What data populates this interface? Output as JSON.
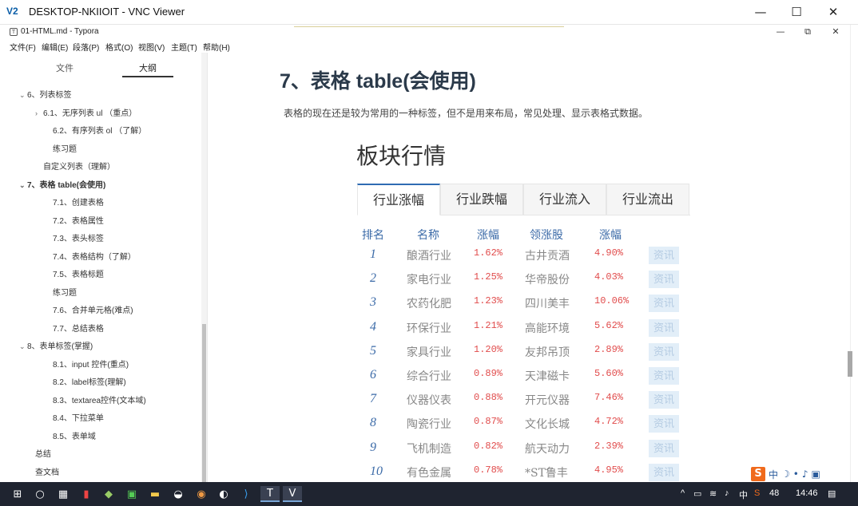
{
  "vnc": {
    "title": "DESKTOP-NKIIOIT - VNC Viewer",
    "logo": "V2",
    "min": "—",
    "max": "☐",
    "close": "✕"
  },
  "typora": {
    "title": "01-HTML.md - Typora",
    "icon": "T",
    "min": "—",
    "max": "⧉",
    "close": "✕"
  },
  "menu": [
    "文件(F)",
    "编辑(E)",
    "段落(P)",
    "格式(O)",
    "视图(V)",
    "主题(T)",
    "帮助(H)"
  ],
  "sidebar": {
    "tabs": [
      "文件",
      "大纲"
    ],
    "active_tab": "大纲",
    "items": [
      {
        "label": "6、列表标签",
        "caret": "⌄",
        "bold": false
      },
      {
        "label": "6.1、无序列表 ul （重点）",
        "caret": "›",
        "bold": false
      },
      {
        "label": "6.2、有序列表 ol （了解）",
        "caret": "",
        "bold": false
      },
      {
        "label": "练习题",
        "caret": "",
        "bold": false
      },
      {
        "label": "自定义列表（理解）",
        "caret": "",
        "bold": false
      },
      {
        "label": "7、表格 table(会使用)",
        "caret": "⌄",
        "bold": true
      },
      {
        "label": "7.1、创建表格",
        "caret": "",
        "bold": false
      },
      {
        "label": "7.2、表格属性",
        "caret": "",
        "bold": false
      },
      {
        "label": "7.3、表头标签",
        "caret": "",
        "bold": false
      },
      {
        "label": "7.4、表格结构（了解）",
        "caret": "",
        "bold": false
      },
      {
        "label": "7.5、表格标题",
        "caret": "",
        "bold": false
      },
      {
        "label": "练习题",
        "caret": "",
        "bold": false
      },
      {
        "label": "7.6、合并单元格(难点)",
        "caret": "",
        "bold": false
      },
      {
        "label": "7.7、总结表格",
        "caret": "",
        "bold": false
      },
      {
        "label": "8、表单标签(掌握)",
        "caret": "⌄",
        "bold": false
      },
      {
        "label": "8.1、input 控件(重点)",
        "caret": "",
        "bold": false
      },
      {
        "label": "8.2、label标签(理解)",
        "caret": "",
        "bold": false
      },
      {
        "label": "8.3、textarea控件(文本域)",
        "caret": "",
        "bold": false
      },
      {
        "label": "8.4、下拉菜单",
        "caret": "",
        "bold": false
      },
      {
        "label": "8.5、表单域",
        "caret": "",
        "bold": false
      },
      {
        "label": "总结",
        "caret": "",
        "bold": false
      },
      {
        "label": "查文档",
        "caret": "",
        "bold": false
      }
    ],
    "footer": {
      "back": "<",
      "source": "</>"
    }
  },
  "main": {
    "heading": "7、表格 table(会使用)",
    "paragraph": "表格的现在还是较为常用的一种标签，但不是用来布局，常见处理、显示表格式数据。",
    "board_title": "板块行情",
    "tabs": [
      "行业涨幅",
      "行业跌幅",
      "行业流入",
      "行业流出"
    ],
    "table": {
      "headers": [
        "排名",
        "名称",
        "涨幅",
        "领涨股",
        "涨幅"
      ],
      "rows": [
        {
          "rank": "1",
          "name": "酿酒行业",
          "pct": "1.62%",
          "lead": "古井贡酒",
          "lead_pct": "4.90%",
          "news": "资讯"
        },
        {
          "rank": "2",
          "name": "家电行业",
          "pct": "1.25%",
          "lead": "华帝股份",
          "lead_pct": "4.03%",
          "news": "资讯"
        },
        {
          "rank": "3",
          "name": "农药化肥",
          "pct": "1.23%",
          "lead": "四川美丰",
          "lead_pct": "10.06%",
          "news": "资讯"
        },
        {
          "rank": "4",
          "name": "环保行业",
          "pct": "1.21%",
          "lead": "高能环境",
          "lead_pct": "5.62%",
          "news": "资讯"
        },
        {
          "rank": "5",
          "name": "家具行业",
          "pct": "1.20%",
          "lead": "友邦吊顶",
          "lead_pct": "2.89%",
          "news": "资讯"
        },
        {
          "rank": "6",
          "name": "综合行业",
          "pct": "0.89%",
          "lead": "天津磁卡",
          "lead_pct": "5.60%",
          "news": "资讯"
        },
        {
          "rank": "7",
          "name": "仪器仪表",
          "pct": "0.88%",
          "lead": "开元仪器",
          "lead_pct": "7.46%",
          "news": "资讯"
        },
        {
          "rank": "8",
          "name": "陶瓷行业",
          "pct": "0.87%",
          "lead": "文化长城",
          "lead_pct": "4.72%",
          "news": "资讯"
        },
        {
          "rank": "9",
          "name": "飞机制造",
          "pct": "0.82%",
          "lead": "航天动力",
          "lead_pct": "2.39%",
          "news": "资讯"
        },
        {
          "rank": "10",
          "name": "有色金属",
          "pct": "0.78%",
          "lead": "*ST鲁丰",
          "lead_pct": "4.95%",
          "news": "资讯"
        }
      ]
    }
  },
  "ime": {
    "logo": "S",
    "mode": "中"
  },
  "taskbar": {
    "time": "14:46",
    "lang": "中",
    "volume": "48"
  }
}
